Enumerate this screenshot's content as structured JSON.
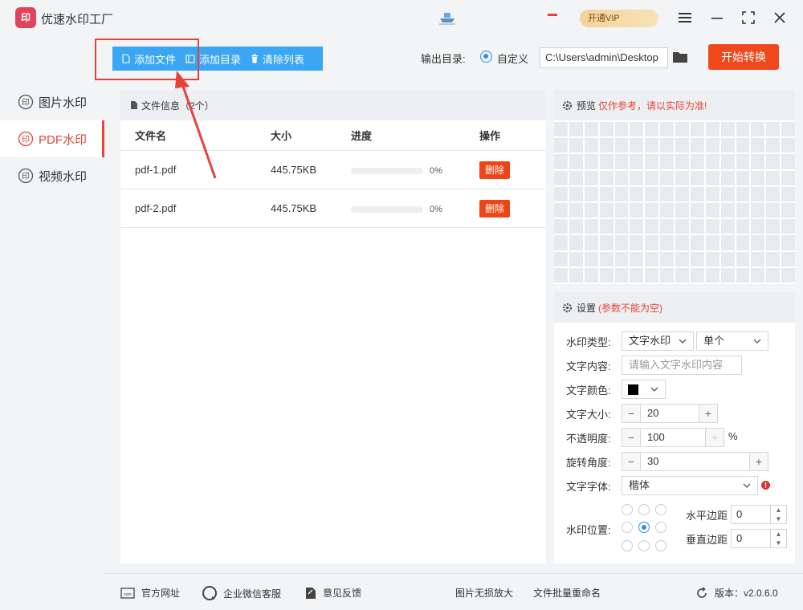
{
  "app": {
    "title": "优速水印工厂",
    "logo_text": "印",
    "promo_text": "开通VIP"
  },
  "sidebar": {
    "items": [
      {
        "label": "图片水印",
        "active": false
      },
      {
        "label": "PDF水印",
        "active": true
      },
      {
        "label": "视频水印",
        "active": false
      }
    ]
  },
  "toolbar": {
    "add_file": "添加文件",
    "add_dir": "添加目录",
    "clear_list": "清除列表"
  },
  "output": {
    "label": "输出目录:",
    "option": "自定义",
    "path": "C:\\Users\\admin\\Desktop"
  },
  "start_button": "开始转换",
  "file_panel": {
    "header": "文件信息（2个）",
    "columns": [
      "文件名",
      "大小",
      "进度",
      "操作"
    ],
    "rows": [
      {
        "name": "pdf-1.pdf",
        "size": "445.75KB",
        "progress": "0%",
        "action": "删除"
      },
      {
        "name": "pdf-2.pdf",
        "size": "445.75KB",
        "progress": "0%",
        "action": "删除"
      }
    ]
  },
  "preview": {
    "label": "预览",
    "note": "仅作参考，请以实际为准!"
  },
  "settings": {
    "label": "设置",
    "note": "(参数不能为空)",
    "watermark_type_label": "水印类型:",
    "watermark_type": "文字水印",
    "watermark_mode": "单个",
    "text_content_label": "文字内容:",
    "text_content_placeholder": "请输入文字水印内容",
    "text_color_label": "文字颜色:",
    "text_color": "#000000",
    "text_size_label": "文字大小:",
    "text_size": "20",
    "opacity_label": "不透明度:",
    "opacity": "100",
    "opacity_unit": "%",
    "rotation_label": "旋转角度:",
    "rotation": "30",
    "font_label": "文字字体:",
    "font": "楷体",
    "position_label": "水印位置:",
    "h_margin_label": "水平边距",
    "h_margin": "0",
    "v_margin_label": "垂直边距",
    "v_margin": "0"
  },
  "footer": {
    "website": "官方网址",
    "wechat": "企业微信客服",
    "feedback": "意见反馈",
    "enlarge": "图片无损放大",
    "rename": "文件批量重命名",
    "version": "版本：v2.0.6.0"
  },
  "colors": {
    "accent": "#3ba6f3",
    "danger": "#ee4516",
    "active": "#e0473a"
  }
}
